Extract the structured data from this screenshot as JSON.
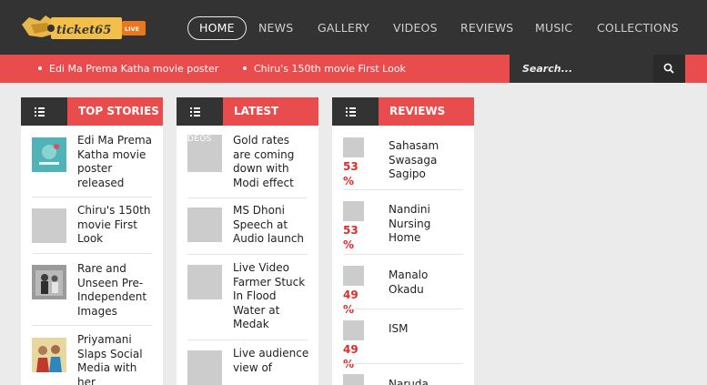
{
  "brand": {
    "logo_text": "ticket65",
    "logo_badge": "LIVE"
  },
  "nav": {
    "items": [
      {
        "label": "HOME"
      },
      {
        "label": "NEWS"
      },
      {
        "label": "GALLERY"
      },
      {
        "label": "VIDEOS"
      },
      {
        "label": "REVIEWS"
      },
      {
        "label": "MUSIC"
      },
      {
        "label": "COLLECTIONS"
      }
    ]
  },
  "ticker": {
    "items": [
      {
        "label": "Edi Ma Prema Katha movie poster"
      },
      {
        "label": "Chiru's 150th movie First Look"
      }
    ]
  },
  "search": {
    "placeholder": "Search...",
    "icon": "search-icon"
  },
  "columns": {
    "top_stories": {
      "title": "TOP STORIES",
      "icon": "list-icon",
      "items": [
        {
          "title": "Edi Ma Prema Katha movie poster released"
        },
        {
          "title": "Chiru's 150th movie First Look"
        },
        {
          "title": "Rare and Unseen Pre-Independent Images"
        },
        {
          "title": "Priyamani Slaps Social Media with her"
        }
      ]
    },
    "latest": {
      "title": "LATEST",
      "icon": "list-icon",
      "thumb_label": "DEOS",
      "items": [
        {
          "title": "Gold rates are coming down with Modi effect"
        },
        {
          "title": "MS Dhoni Speech at Audio launch"
        },
        {
          "title": "Live Video Farmer Stuck In Flood Water at Medak"
        },
        {
          "title": "Live audience view of"
        }
      ]
    },
    "reviews": {
      "title": "REVIEWS",
      "icon": "list-icon",
      "items": [
        {
          "title": "Sahasam Swasaga Sagipo",
          "rating": "53 %"
        },
        {
          "title": "Nandini Nursing Home",
          "rating": "53 %"
        },
        {
          "title": "Manalo Okadu",
          "rating": "49 %"
        },
        {
          "title": "ISM",
          "rating": "49 %"
        },
        {
          "title": "Naruda",
          "rating": ""
        }
      ]
    }
  },
  "colors": {
    "accent": "#e84c4c",
    "dark": "#333333",
    "rating": "#e02b2b",
    "page_bg": "#ebebeb"
  }
}
